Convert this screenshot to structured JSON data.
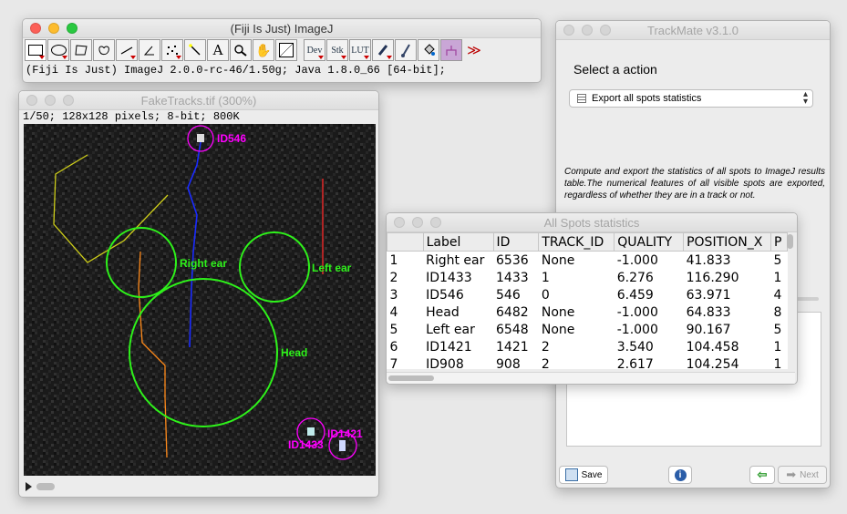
{
  "imagej": {
    "title": "(Fiji Is Just) ImageJ",
    "status": "(Fiji Is Just) ImageJ 2.0.0-rc-46/1.50g; Java 1.8.0_66 [64-bit];",
    "tools": {
      "dev": "Dev",
      "stk": "Stk",
      "lut": "LUT",
      "more": "≫"
    }
  },
  "image_window": {
    "title": "FakeTracks.tif (300%)",
    "info": "1/50; 128x128 pixels; 8-bit; 800K",
    "labels": {
      "id546": "ID546",
      "right_ear": "Right ear",
      "left_ear": "Left ear",
      "head": "Head",
      "id1421": "ID1421",
      "id1433": "ID1433"
    },
    "colors": {
      "roi": "#2ef21a",
      "spot": "#ff00ff",
      "track_blue": "#1a2bff",
      "track_orange": "#ff8a1a",
      "track_yellow": "#cfcf1a",
      "track_red": "#ff2a2a"
    }
  },
  "trackmate": {
    "title": "TrackMate v3.1.0",
    "prompt": "Select a action",
    "selected_action": "Export all spots statistics",
    "description": "Compute and export the statistics of all spots to ImageJ results table.The numerical features of all visible spots are exported, regardless of whether they are in a track or not.",
    "save_label": "Save",
    "next_label": "Next",
    "info_icon": "info-icon",
    "back_icon": "back-arrow-icon"
  },
  "spots": {
    "title": "All Spots statistics",
    "columns": [
      "",
      "Label",
      "ID",
      "TRACK_ID",
      "QUALITY",
      "POSITION_X",
      "P"
    ],
    "rows": [
      [
        "1",
        "Right ear",
        "6536",
        "None",
        "-1.000",
        "41.833",
        "5"
      ],
      [
        "2",
        "ID1433",
        "1433",
        "1",
        "6.276",
        "116.290",
        "1"
      ],
      [
        "3",
        "ID546",
        "546",
        "0",
        "6.459",
        "63.971",
        "4"
      ],
      [
        "4",
        "Head",
        "6482",
        "None",
        "-1.000",
        "64.833",
        "8"
      ],
      [
        "5",
        "Left ear",
        "6548",
        "None",
        "-1.000",
        "90.167",
        "5"
      ],
      [
        "6",
        "ID1421",
        "1421",
        "2",
        "3.540",
        "104.458",
        "1"
      ],
      [
        "7",
        "ID908",
        "908",
        "2",
        "2.617",
        "104.254",
        "1"
      ]
    ]
  }
}
